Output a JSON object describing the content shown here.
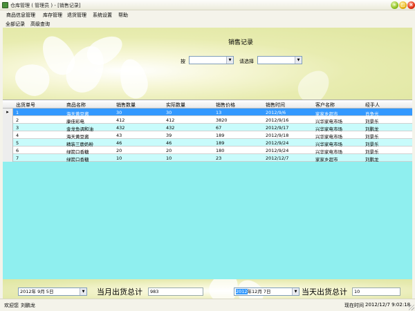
{
  "window": {
    "title": "仓库管理 ( 管理员 ) - [销售记录]"
  },
  "menu": [
    "商品信息管理",
    "库存管理",
    "退货管理",
    "系统设置",
    "帮助"
  ],
  "tabs": [
    "全部记录",
    "高级查询"
  ],
  "header": {
    "title": "销售记录",
    "by_label": "按",
    "choose_label": "请选择",
    "by_value": "",
    "choose_value": ""
  },
  "grid": {
    "columns": [
      "出货单号",
      "商品名称",
      "销售数量",
      "实际数量",
      "销售价格",
      "销售时间",
      "客户名称",
      "经手人"
    ],
    "rows": [
      [
        "1",
        "海天黄豆酱",
        "30",
        "30",
        "13",
        "2012/9/6",
        "家家乡超市",
        "肖争光"
      ],
      [
        "2",
        "康佳彩电",
        "412",
        "412",
        "3820",
        "2012/9/16",
        "兴华家电市场",
        "刘景乐"
      ],
      [
        "3",
        "金龙鱼调和油",
        "432",
        "432",
        "67",
        "2012/9/17",
        "兴华家电市场",
        "刘鹏龙"
      ],
      [
        "4",
        "海天黄豆酱",
        "43",
        "39",
        "189",
        "2012/9/18",
        "兴华家电市场",
        "刘景乐"
      ],
      [
        "5",
        "精装三鹿奶粉",
        "46",
        "46",
        "189",
        "2012/9/24",
        "兴华家电市场",
        "刘景乐"
      ],
      [
        "6",
        "绿箭口香糖",
        "20",
        "20",
        "180",
        "2012/9/24",
        "兴华家电市场",
        "刘景乐"
      ],
      [
        "7",
        "绿箭口香糖",
        "10",
        "10",
        "23",
        "2012/12/7",
        "家家乡超市",
        "刘鹏龙"
      ]
    ]
  },
  "footer": {
    "month_date": "2012年 9月 5日",
    "month_total_label": "当月出货总计",
    "month_total": "983",
    "day_date_year": "2012",
    "day_date_rest": "年12月 7日",
    "day_total_label": "当天出货总计",
    "day_total": "10"
  },
  "status": {
    "welcome": "欢迎您",
    "user": "刘鹏龙",
    "now_label": "现在时间",
    "now_value": "2012/12/7 9:02:18"
  },
  "colors": {
    "selected_row": "#3399ff",
    "grid_bg": "#8fefef",
    "alt_row": "#c8fbfb"
  }
}
